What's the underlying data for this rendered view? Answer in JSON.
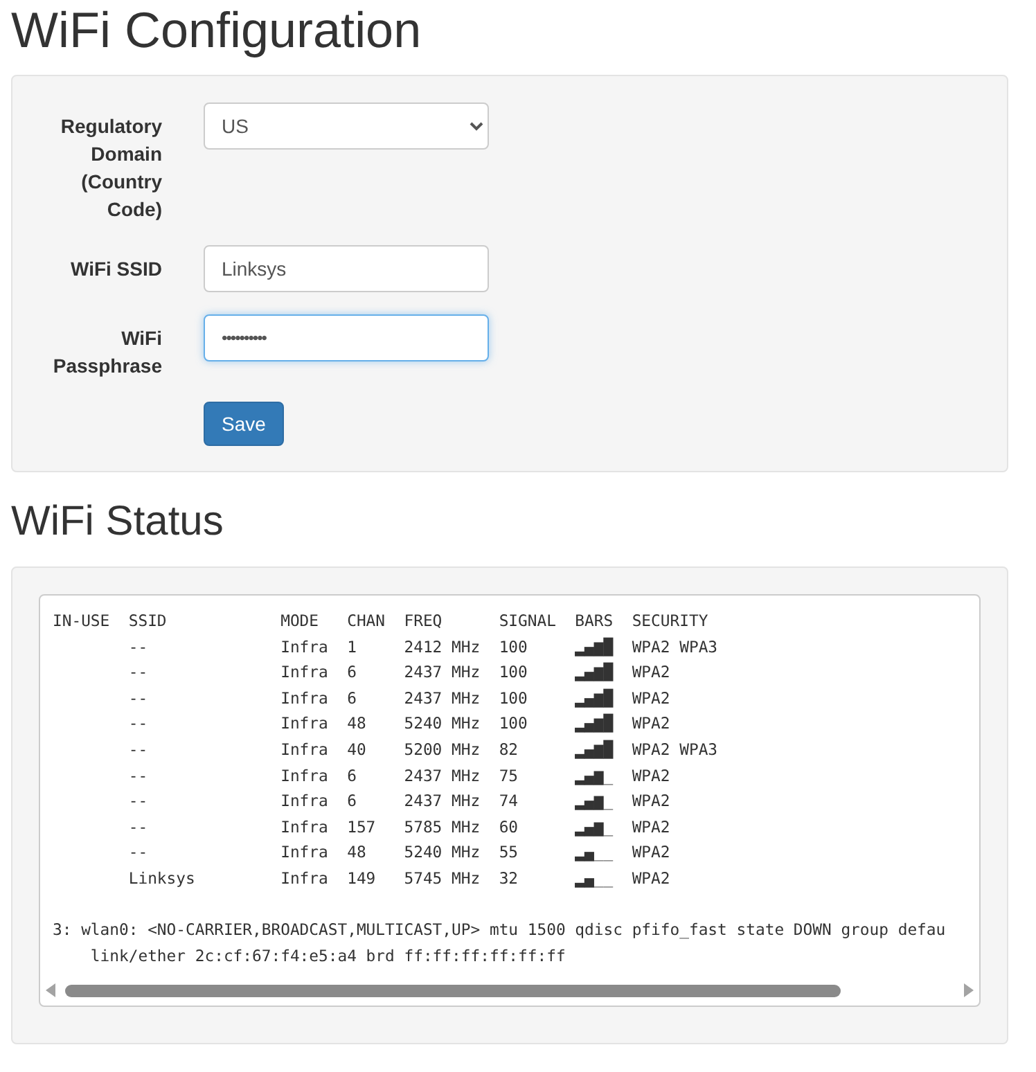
{
  "config": {
    "title": "WiFi Configuration",
    "fields": [
      {
        "kind": "select",
        "label": "Regulatory Domain (Country Code)",
        "value": "US",
        "focused": false
      },
      {
        "kind": "text",
        "label": "WiFi SSID",
        "value": "Linksys",
        "focused": false
      },
      {
        "kind": "password",
        "label": "WiFi Passphrase",
        "value": "••••••••••",
        "focused": true
      }
    ],
    "save_button": "Save"
  },
  "status": {
    "title": "WiFi Status",
    "scan_lines": [
      "IN-USE  SSID            MODE   CHAN  FREQ      SIGNAL  BARS  SECURITY",
      "        --              Infra  1     2412 MHz  100     ▂▄▆█  WPA2 WPA3",
      "        --              Infra  6     2437 MHz  100     ▂▄▆█  WPA2",
      "        --              Infra  6     2437 MHz  100     ▂▄▆█  WPA2",
      "        --              Infra  48    5240 MHz  100     ▂▄▆█  WPA2",
      "        --              Infra  40    5200 MHz  82      ▂▄▆█  WPA2 WPA3",
      "        --              Infra  6     2437 MHz  75      ▂▄▆_  WPA2",
      "        --              Infra  6     2437 MHz  74      ▂▄▆_  WPA2",
      "        --              Infra  157   5785 MHz  60      ▂▄▆_  WPA2",
      "        --              Infra  48    5240 MHz  55      ▂▄__  WPA2",
      "        Linksys         Infra  149   5745 MHz  32      ▂▄__  WPA2"
    ],
    "link_lines": [
      "3: wlan0: <NO-CARRIER,BROADCAST,MULTICAST,UP> mtu 1500 qdisc pfifo_fast state DOWN group defau",
      "    link/ether 2c:cf:67:f4:e5:a4 brd ff:ff:ff:ff:ff:ff"
    ]
  }
}
